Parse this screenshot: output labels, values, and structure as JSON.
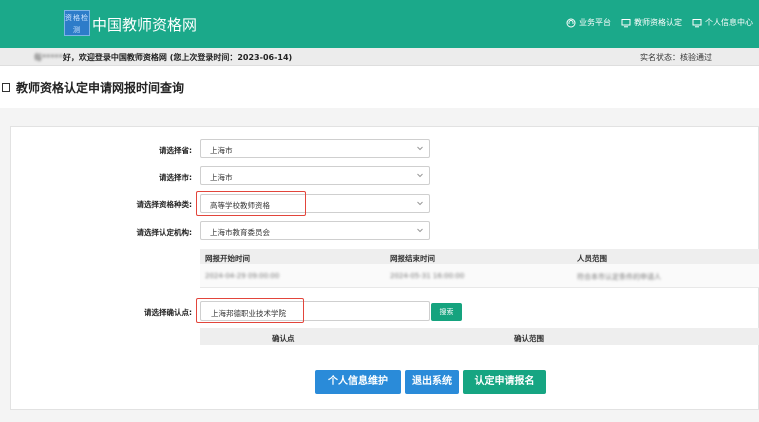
{
  "header": {
    "logo_text": "资格检测",
    "site_title": "中国教师资格网",
    "nav": [
      {
        "label": "业务平台",
        "icon": "headset-icon"
      },
      {
        "label": "教师资格认定",
        "icon": "monitor-icon"
      },
      {
        "label": "个人信息中心",
        "icon": "monitor-icon"
      }
    ],
    "bg_color": "#1ba98a"
  },
  "welcome": {
    "name": "每*****",
    "text": "好，欢迎登录中国教师资格网 (您上次登录时间：2023-06-14)",
    "realname_status": "实名状态：核验通过"
  },
  "page_title": "教师资格认定申请网报时间查询",
  "form": {
    "province_label": "请选择省:",
    "province_value": "上海市",
    "city_label": "请选择市:",
    "city_value": "上海市",
    "type_label": "请选择资格种类:",
    "type_value": "高等学校教师资格",
    "org_label": "请选择认定机构:",
    "org_value": "上海市教育委员会",
    "point_label": "请选择确认点:",
    "point_value": "上海邦德职业技术学院",
    "search_label": "搜索"
  },
  "period_table": {
    "headers": [
      "网报开始时间",
      "网报结束时间",
      "人员范围"
    ],
    "rows": [
      [
        "2024-04-29 09:00:00",
        "2024-05-31 16:00:00",
        "符合本市认定条件的申请人"
      ]
    ]
  },
  "point_table": {
    "headers": [
      "确认点",
      "确认范围"
    ]
  },
  "buttons": {
    "profile": "个人信息维护",
    "logout": "退出系统",
    "apply": "认定申请报名"
  },
  "colors": {
    "accent": "#1ba98a",
    "button_blue": "#2a8bd9",
    "button_green": "#16a582",
    "highlight_red": "#e2453b"
  }
}
